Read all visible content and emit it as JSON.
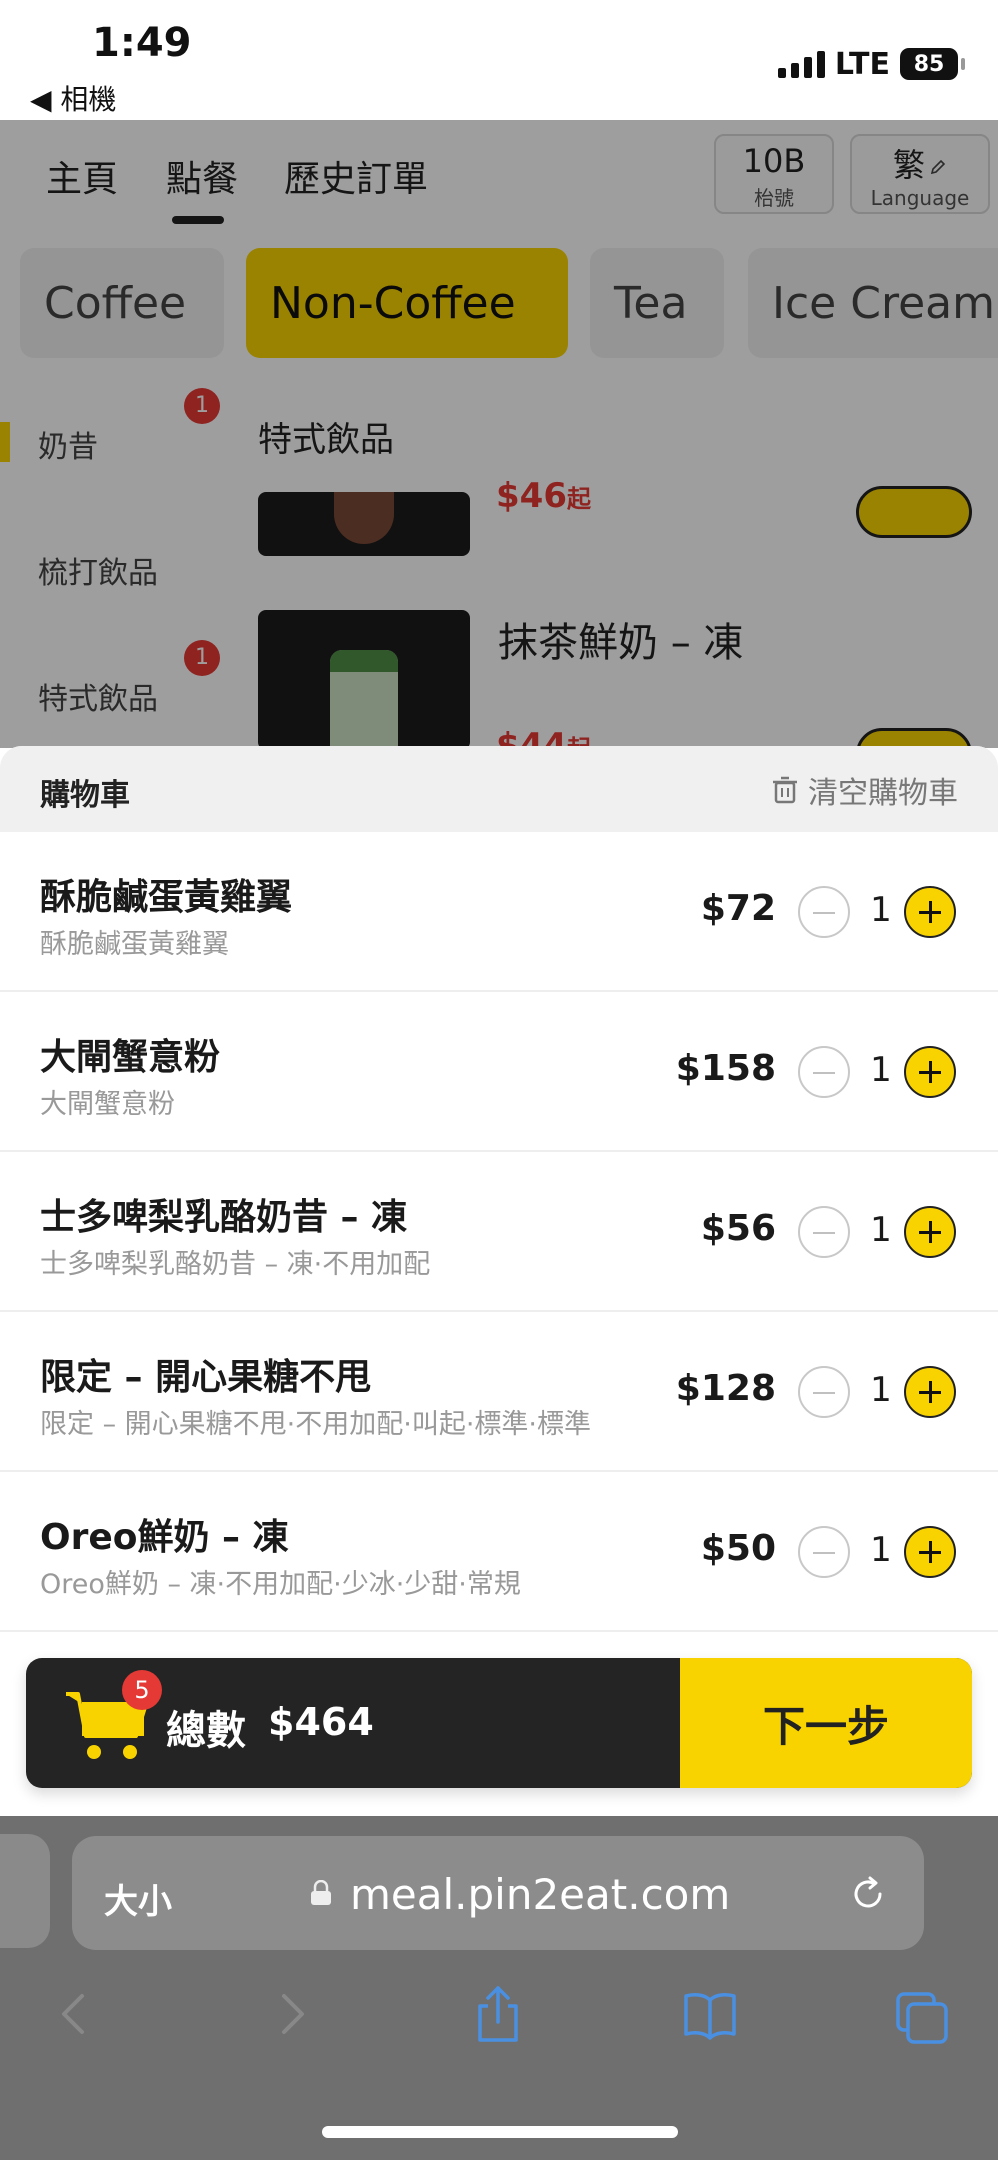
{
  "status_bar": {
    "time": "1:49",
    "back_label": "◀ 相機",
    "network": "LTE",
    "battery": "85"
  },
  "nav": {
    "home": "主頁",
    "order": "點餐",
    "history": "歷史訂單"
  },
  "table": {
    "number": "10B",
    "label": "枱號"
  },
  "language": {
    "label": "繁",
    "sub": "Language"
  },
  "categories": [
    "Coffee",
    "Non-Coffee",
    "Tea",
    "Ice Cream"
  ],
  "sidebar": [
    {
      "label": "奶昔",
      "badge": "1"
    },
    {
      "label": "梳打飲品"
    },
    {
      "label": "特式飲品",
      "badge": "1"
    }
  ],
  "section_title": "特式飲品",
  "menu_items": [
    {
      "price": "$46",
      "price_suffix": "起"
    },
    {
      "name": "抹茶鮮奶 – 凍",
      "price": "$44",
      "price_suffix": "起"
    }
  ],
  "cart": {
    "title": "購物車",
    "clear_label": "清空購物車",
    "items": [
      {
        "name": "酥脆鹹蛋黃雞翼",
        "desc": "酥脆鹹蛋黃雞翼",
        "price": "$72",
        "qty": "1"
      },
      {
        "name": "大閘蟹意粉",
        "desc": "大閘蟹意粉",
        "price": "$158",
        "qty": "1"
      },
      {
        "name": "士多啤梨乳酪奶昔 – 凍",
        "desc": "士多啤梨乳酪奶昔 – 凍·不用加配",
        "price": "$56",
        "qty": "1"
      },
      {
        "name": "限定 – 開心果糖不甩",
        "desc": "限定 – 開心果糖不甩·不用加配·叫起·標準·標準",
        "price": "$128",
        "qty": "1"
      },
      {
        "name": "Oreo鮮奶 – 凍",
        "desc": "Oreo鮮奶 – 凍·不用加配·少冰·少甜·常規",
        "price": "$50",
        "qty": "1"
      }
    ]
  },
  "checkout": {
    "badge": "5",
    "total_label": "總數",
    "total_value": "$464",
    "next_label": "下一步"
  },
  "browser": {
    "text_size": "大小",
    "url": "meal.pin2eat.com"
  },
  "colors": {
    "accent": "#f8d300",
    "dark": "#242424",
    "badge": "#e53935",
    "safari_blue": "#4a90e2"
  }
}
